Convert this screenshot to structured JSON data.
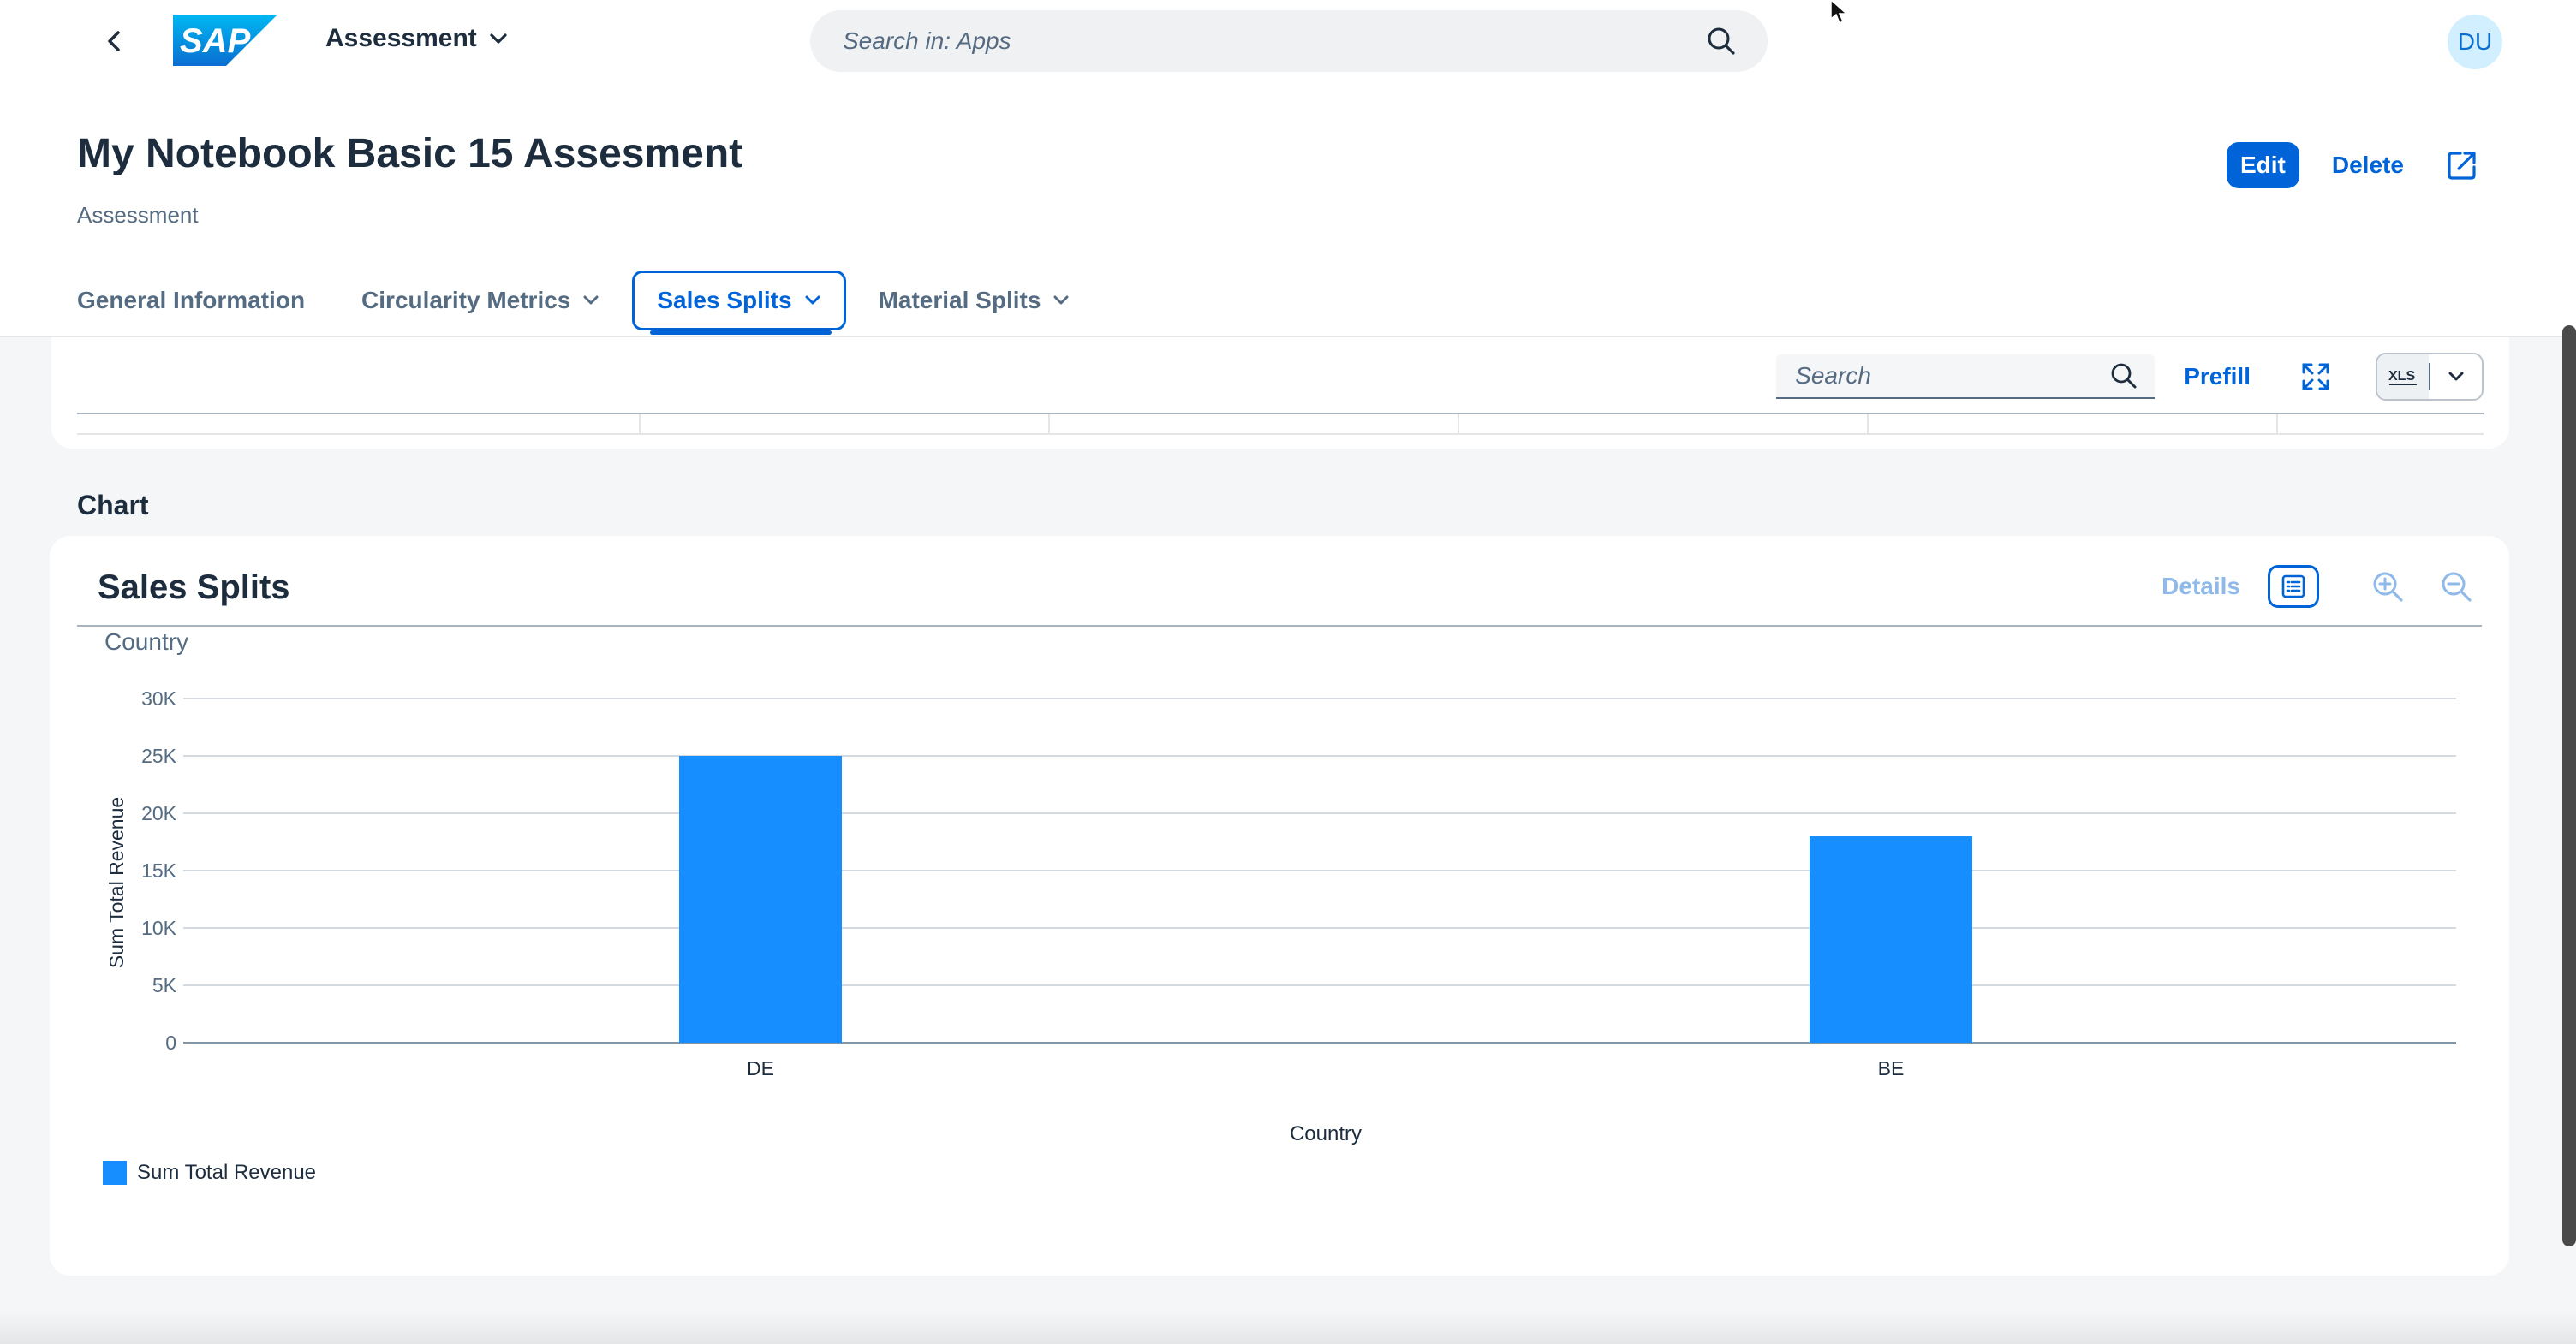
{
  "shell": {
    "app_title": "Assessment",
    "logo_text": "SAP",
    "search_placeholder": "Search in: Apps",
    "avatar_initials": "DU"
  },
  "header": {
    "title": "My Notebook Basic 15 Assesment",
    "subtitle": "Assessment",
    "actions": {
      "edit": "Edit",
      "delete": "Delete"
    }
  },
  "tabs": [
    {
      "label": "General Information",
      "has_menu": false,
      "active": false
    },
    {
      "label": "Circularity Metrics",
      "has_menu": true,
      "active": false
    },
    {
      "label": "Sales Splits",
      "has_menu": true,
      "active": true
    },
    {
      "label": "Material Splits",
      "has_menu": true,
      "active": false
    }
  ],
  "table_toolbar": {
    "search_placeholder": "Search",
    "prefill": "Prefill"
  },
  "chart_section": {
    "heading": "Chart",
    "card_title": "Sales Splits",
    "details": "Details",
    "dimension_label": "Country"
  },
  "colors": {
    "brand": "#0064d9",
    "bar": "#168eff"
  },
  "chart_data": {
    "type": "bar",
    "categories": [
      "DE",
      "BE"
    ],
    "series": [
      {
        "name": "Sum Total Revenue",
        "values": [
          25000,
          18000
        ]
      }
    ],
    "xlabel": "Country",
    "ylabel": "Sum Total Revenue",
    "ylim": [
      0,
      30000
    ],
    "yticks": [
      "0",
      "5K",
      "10K",
      "15K",
      "20K",
      "25K",
      "30K"
    ],
    "grid": true,
    "legend": "bottom-left"
  }
}
